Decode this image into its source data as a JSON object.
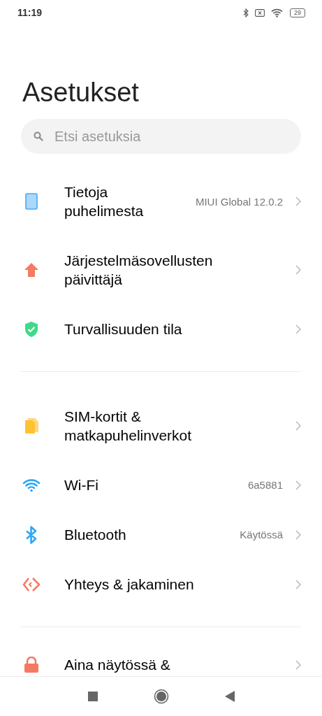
{
  "status_bar": {
    "time": "11:19",
    "battery": "29"
  },
  "title": "Asetukset",
  "search": {
    "placeholder": "Etsi asetuksia"
  },
  "sections": [
    {
      "items": [
        {
          "kind": "phone",
          "label": "Tietoja puhelimesta",
          "value": "MIUI Global 12.0.2"
        },
        {
          "kind": "update",
          "label": "Järjestelmäsovellusten päivittäjä"
        },
        {
          "kind": "security",
          "label": "Turvallisuuden tila"
        }
      ]
    },
    {
      "items": [
        {
          "kind": "sim",
          "label": "SIM-kortit & matkapuhelinverkot"
        },
        {
          "kind": "wifi",
          "label": "Wi-Fi",
          "value": "6a5881"
        },
        {
          "kind": "bluetooth",
          "label": "Bluetooth",
          "value": "Käytössä"
        },
        {
          "kind": "share",
          "label": "Yhteys & jakaminen"
        }
      ]
    },
    {
      "items": [
        {
          "kind": "lock",
          "label": "Aina näytössä &"
        }
      ]
    }
  ]
}
